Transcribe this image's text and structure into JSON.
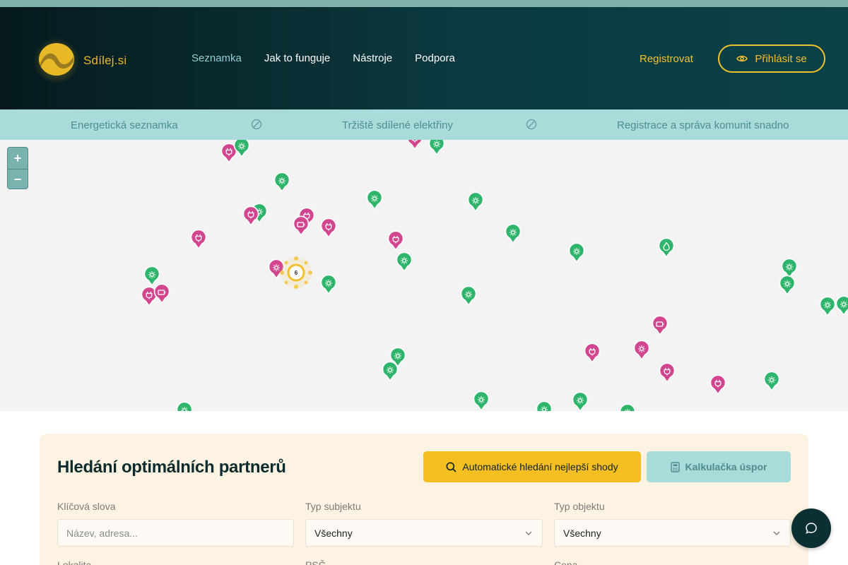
{
  "brand": {
    "name": "Sdílej.si"
  },
  "nav": {
    "items": [
      {
        "label": "Seznamka",
        "active": true
      },
      {
        "label": "Jak to funguje",
        "active": false
      },
      {
        "label": "Nástroje",
        "active": false
      },
      {
        "label": "Podpora",
        "active": false
      }
    ]
  },
  "auth": {
    "register_label": "Registrovat",
    "login_label": "Přihlásit se"
  },
  "ticker": {
    "items": [
      "Energetická seznamka",
      "Tržiště sdílené elektřiny",
      "Registrace a správa komunit snadno"
    ]
  },
  "map": {
    "zoom_in": "+",
    "zoom_out": "−",
    "cluster_count": "6",
    "marker_types": {
      "sun-icon": "producer (green)",
      "plug-icon": "consumer (pink)",
      "battery-icon": "storage (pink)",
      "flame-icon": "heat (green)"
    },
    "colors": {
      "producer": "#2fb56b",
      "consumer": "#d1468f",
      "accent": "#f2c02e"
    }
  },
  "search": {
    "title": "Hledání optimálních partnerů",
    "auto_button": "Automatické hledání nejlepší shody",
    "calc_button": "Kalkulačka úspor",
    "filters": {
      "keywords": {
        "label": "Klíčová slova",
        "placeholder": "Název, adresa..."
      },
      "subject_type": {
        "label": "Typ subjektu",
        "value": "Všechny"
      },
      "object_type": {
        "label": "Typ objektu",
        "value": "Všechny"
      },
      "location": {
        "label": "Lokalita"
      },
      "postcode": {
        "label": "PSČ"
      },
      "price": {
        "label": "Cena"
      }
    }
  },
  "colors": {
    "header_dark": "#061a1d",
    "ticker_bg": "#a8dbda",
    "accent_yellow": "#f5bf22",
    "panel_bg": "#fdf3e2",
    "chat_bg": "#0b2f33"
  }
}
